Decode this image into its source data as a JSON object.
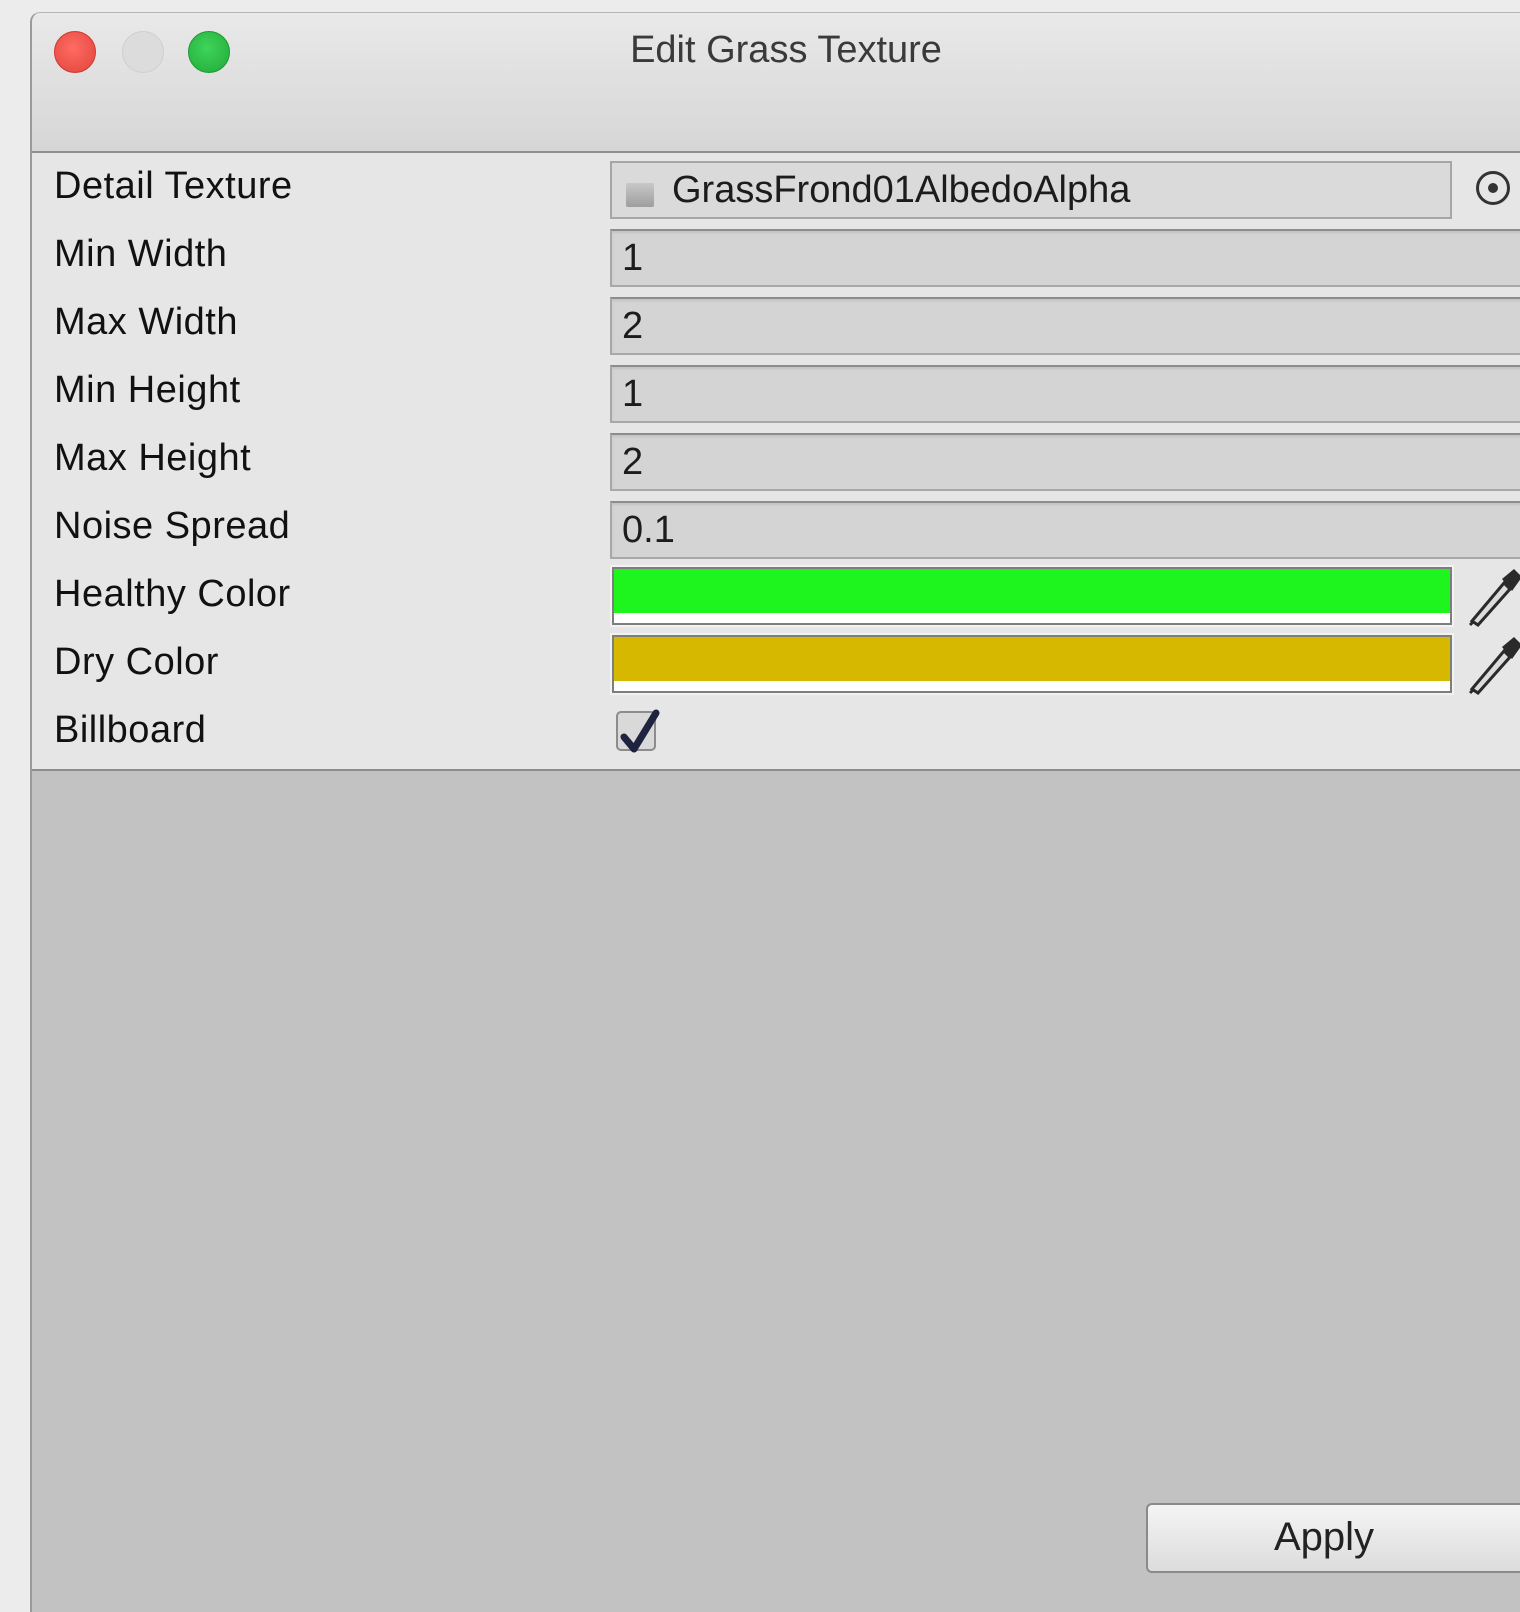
{
  "window": {
    "title": "Edit Grass Texture"
  },
  "fields": {
    "detail_texture": {
      "label": "Detail Texture",
      "value": "GrassFrond01AlbedoAlpha",
      "picker_icon": "object-picker-icon"
    },
    "min_width": {
      "label": "Min Width",
      "value": "1"
    },
    "max_width": {
      "label": "Max Width",
      "value": "2"
    },
    "min_height": {
      "label": "Min Height",
      "value": "1"
    },
    "max_height": {
      "label": "Max Height",
      "value": "2"
    },
    "noise_spread": {
      "label": "Noise Spread",
      "value": "0.1"
    },
    "healthy_color": {
      "label": "Healthy Color",
      "color": "#1ef51e",
      "icon": "eyedropper-icon"
    },
    "dry_color": {
      "label": "Dry Color",
      "color": "#d6b800",
      "icon": "eyedropper-icon"
    },
    "billboard": {
      "label": "Billboard",
      "checked": true
    }
  },
  "buttons": {
    "apply_label": "Apply"
  }
}
